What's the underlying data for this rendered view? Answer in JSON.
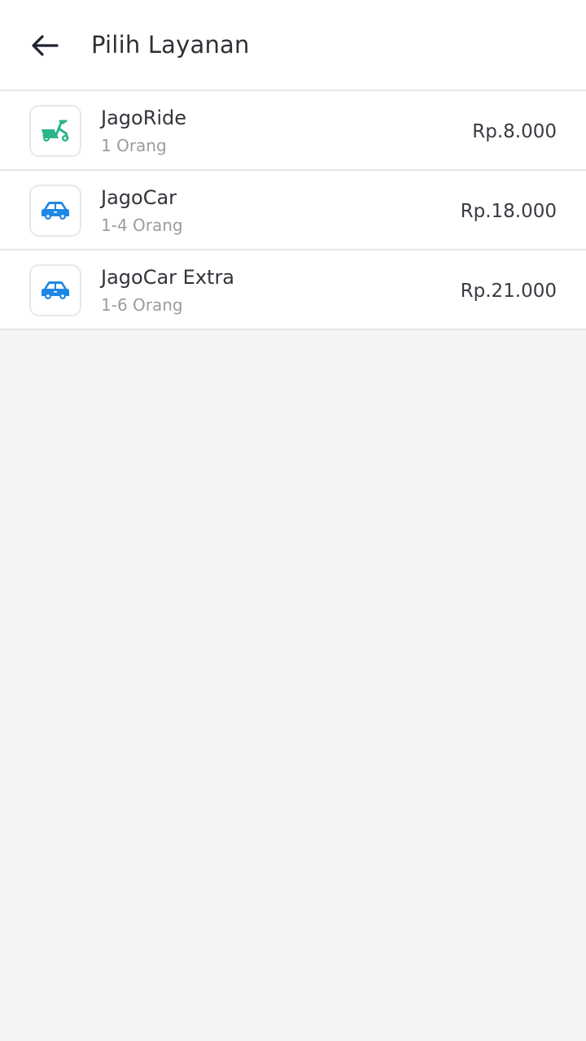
{
  "header": {
    "title": "Pilih Layanan",
    "back_icon": "arrow-left-icon"
  },
  "services": [
    {
      "name": "JagoRide",
      "capacity": "1 Orang",
      "price": "Rp.8.000",
      "icon": "scooter-icon",
      "icon_color": "#2bb58a"
    },
    {
      "name": "JagoCar",
      "capacity": "1-4 Orang",
      "price": "Rp.18.000",
      "icon": "car-icon",
      "icon_color": "#1e88e5"
    },
    {
      "name": "JagoCar Extra",
      "capacity": "1-6 Orang",
      "price": "Rp.21.000",
      "icon": "car-icon",
      "icon_color": "#1e88e5"
    }
  ],
  "colors": {
    "background": "#f4f4f4",
    "surface": "#ffffff",
    "divider": "#e6e6e6",
    "text_primary": "#2f3036",
    "text_secondary": "#9b9ca2"
  }
}
